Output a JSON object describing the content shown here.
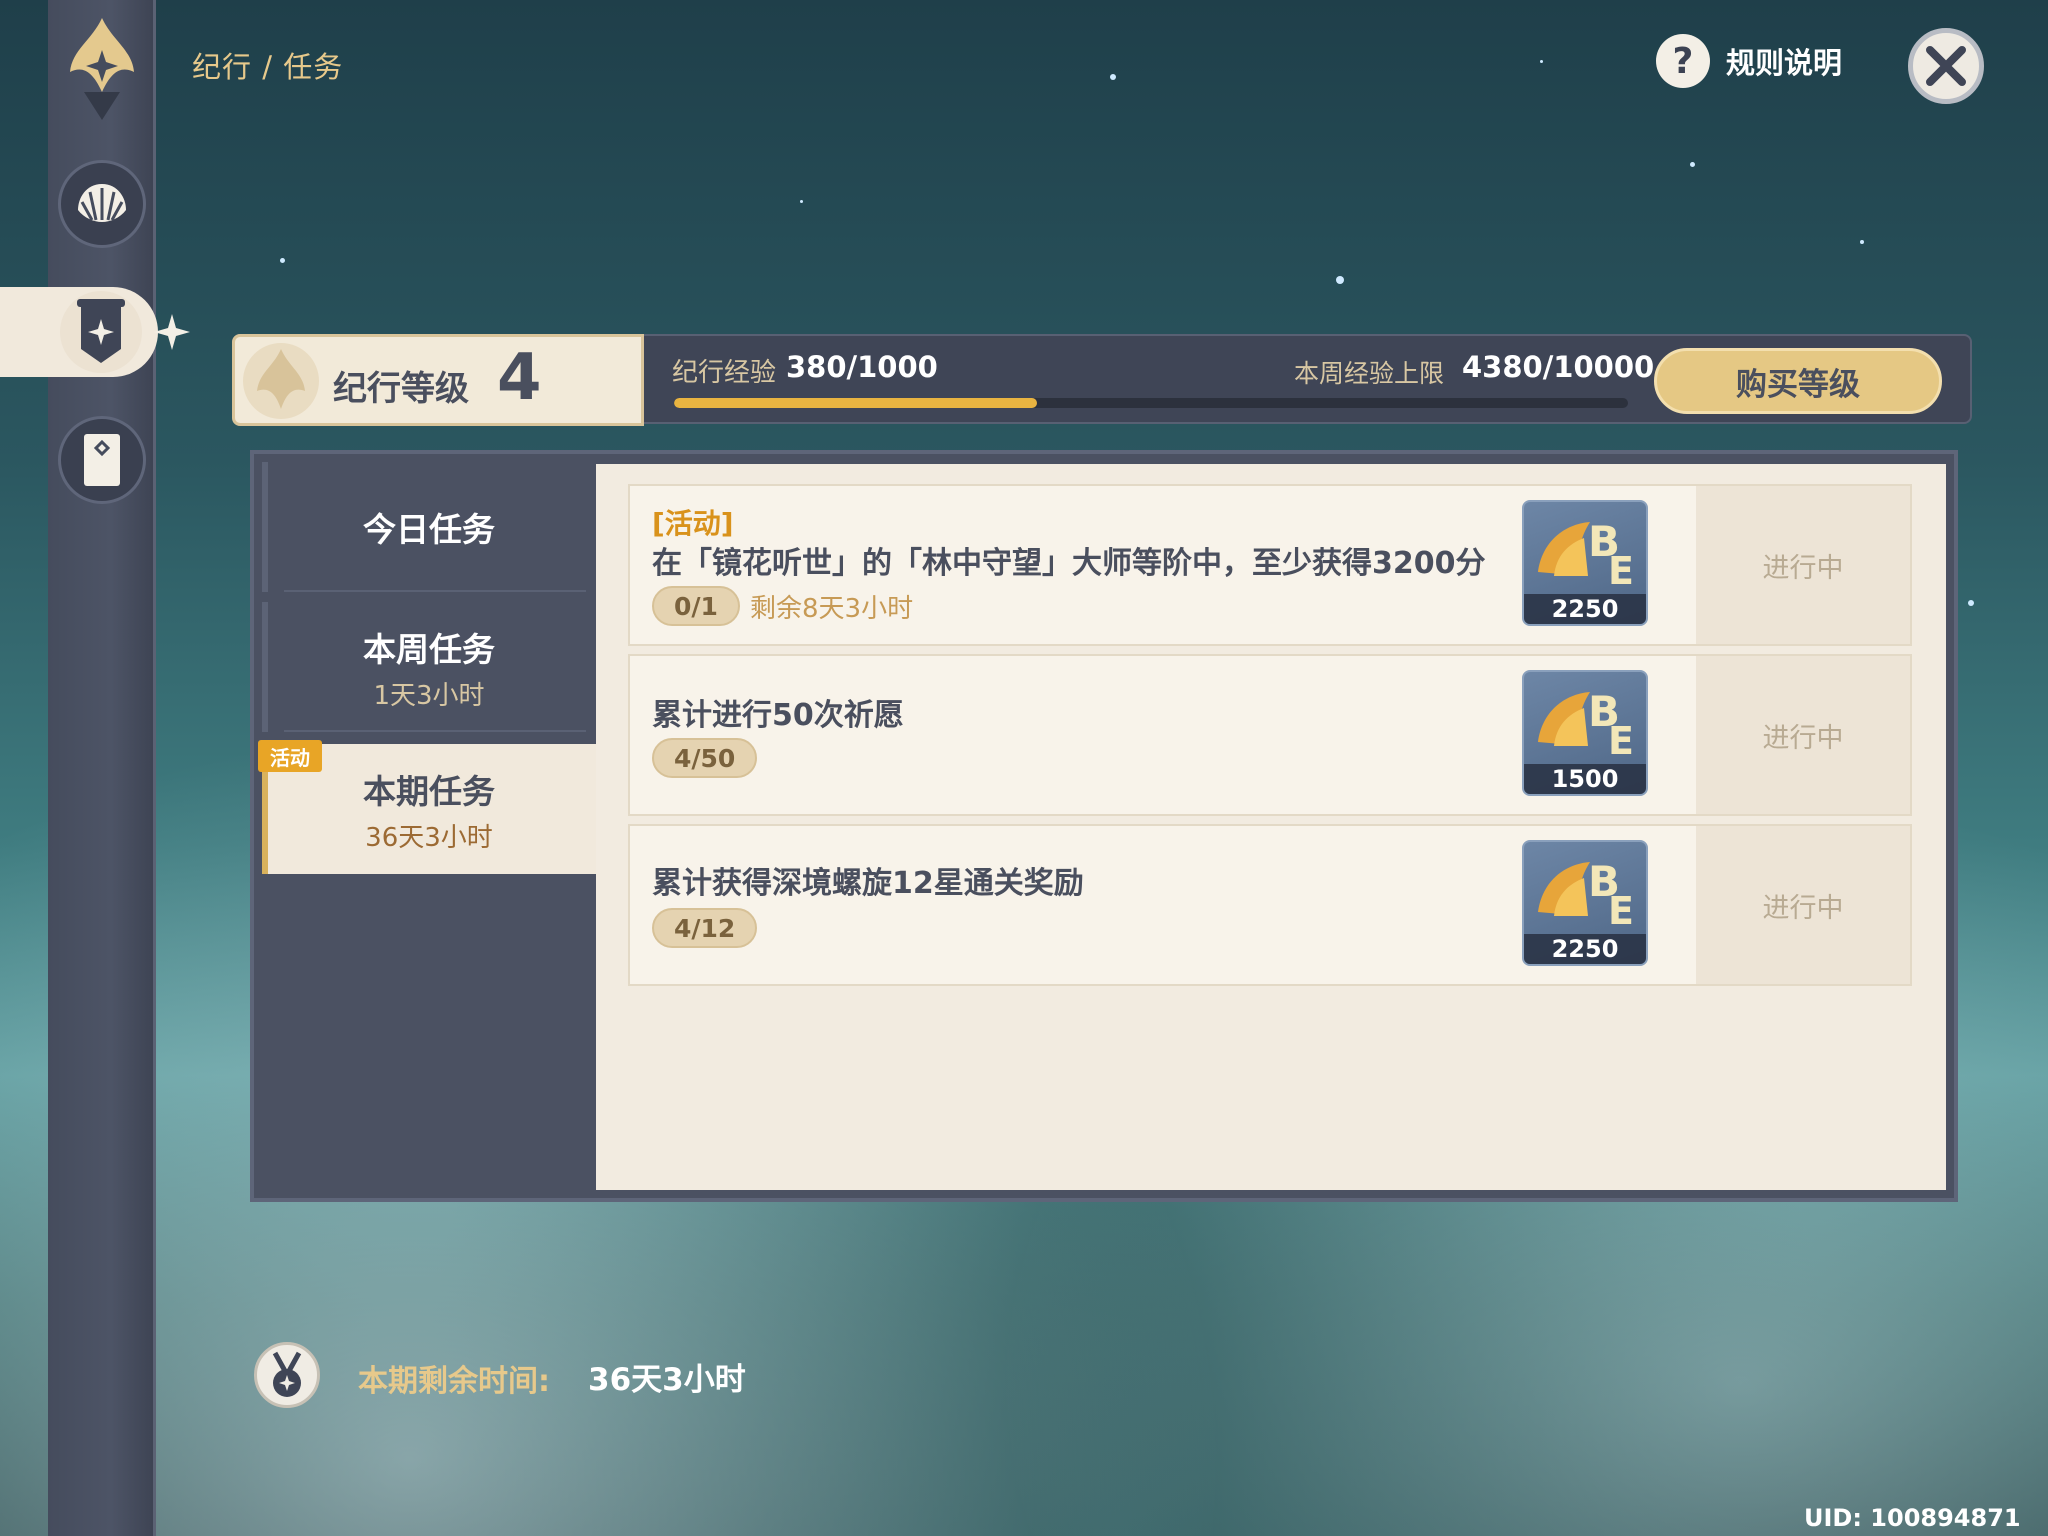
{
  "breadcrumb": "纪行 / 任务",
  "help_label": "规则说明",
  "level": {
    "label": "纪行等级",
    "value": "4",
    "exp_label": "纪行经验",
    "exp_value": "380/1000",
    "exp_progress": 0.38,
    "week_label": "本周经验上限",
    "week_value": "4380/10000",
    "buy_label": "购买等级"
  },
  "tabs": [
    {
      "title": "今日任务",
      "sub": ""
    },
    {
      "title": "本周任务",
      "sub": "1天3小时"
    },
    {
      "title": "本期任务",
      "sub": "36天3小时",
      "badge": "活动",
      "active": true
    }
  ],
  "tasks": [
    {
      "tag": "[活动]",
      "title": "在「镜花听世」的「林中守望」大师等阶中，至少获得3200分",
      "progress": "0/1",
      "remain": "剩余8天3小时",
      "reward": "2250",
      "status": "进行中"
    },
    {
      "tag": "",
      "title": "累计进行50次祈愿",
      "progress": "4/50",
      "remain": "",
      "reward": "1500",
      "status": "进行中"
    },
    {
      "tag": "",
      "title": "累计获得深境螺旋12星通关奖励",
      "progress": "4/12",
      "remain": "",
      "reward": "2250",
      "status": "进行中"
    }
  ],
  "footer": {
    "label": "本期剩余时间:",
    "value": "36天3小时"
  },
  "uid": "UID: 100894871",
  "icons": {
    "logo": "emblem-icon",
    "shell": "shell-icon",
    "banner": "banner-icon",
    "book": "book-icon",
    "help": "question-icon",
    "close": "close-icon",
    "reward": "battle-pass-exp-icon"
  },
  "colors": {
    "accent_gold": "#e5c884",
    "progress_fill": "#e9b441",
    "activity_orange": "#e8a526",
    "panel_dark": "#4b5162",
    "panel_light": "#f2ebe0"
  }
}
